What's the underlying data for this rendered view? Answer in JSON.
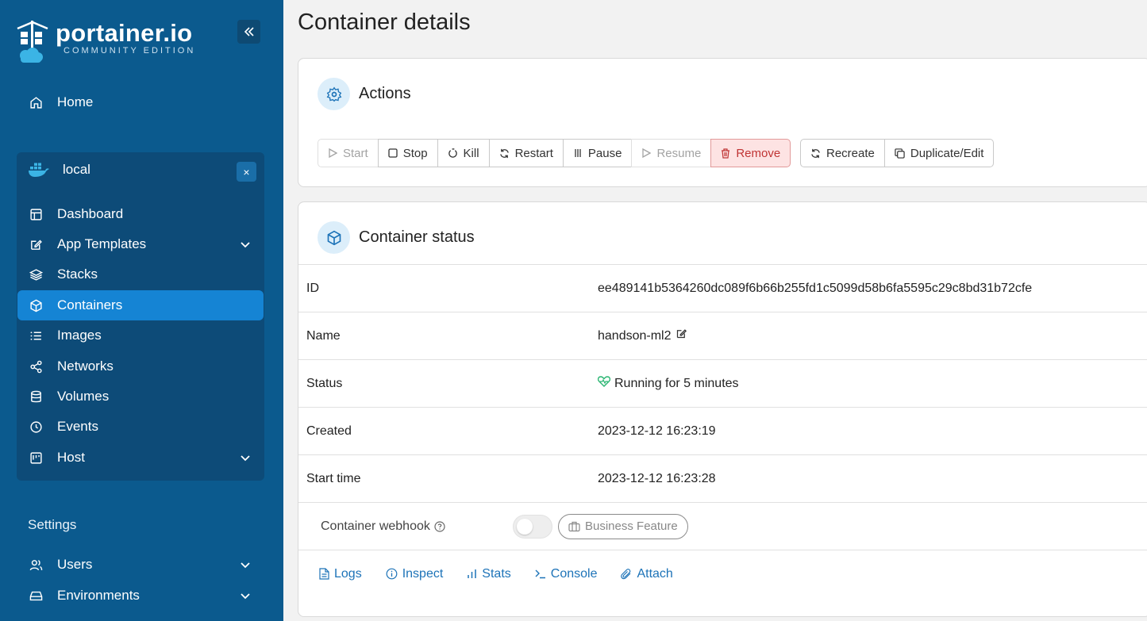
{
  "sidebar": {
    "logo_name": "portainer.io",
    "logo_sub": "COMMUNITY EDITION",
    "home": "Home",
    "environment": {
      "name": "local",
      "close": "×",
      "items": [
        {
          "label": "Dashboard",
          "icon": "dashboard-icon"
        },
        {
          "label": "App Templates",
          "icon": "edit-icon"
        },
        {
          "label": "Stacks",
          "icon": "layers-icon"
        },
        {
          "label": "Containers",
          "icon": "box-icon"
        },
        {
          "label": "Images",
          "icon": "list-icon"
        },
        {
          "label": "Networks",
          "icon": "share-icon"
        },
        {
          "label": "Volumes",
          "icon": "database-icon"
        },
        {
          "label": "Events",
          "icon": "clock-icon"
        },
        {
          "label": "Host",
          "icon": "board-icon"
        }
      ]
    },
    "settings_title": "Settings",
    "settings_items": [
      {
        "label": "Users",
        "icon": "users-icon"
      },
      {
        "label": "Environments",
        "icon": "drive-icon"
      }
    ]
  },
  "page": {
    "title": "Container details"
  },
  "actions": {
    "title": "Actions",
    "buttons": {
      "start": "Start",
      "stop": "Stop",
      "kill": "Kill",
      "restart": "Restart",
      "pause": "Pause",
      "resume": "Resume",
      "remove": "Remove",
      "recreate": "Recreate",
      "duplicate": "Duplicate/Edit"
    }
  },
  "status": {
    "title": "Container status",
    "rows": {
      "id": {
        "key": "ID",
        "value": "ee489141b5364260dc089f6b66b255fd1c5099d58b6fa5595c29c8bd31b72cfe"
      },
      "name": {
        "key": "Name",
        "value": "handson-ml2"
      },
      "status": {
        "key": "Status",
        "value": "Running for 5 minutes"
      },
      "created": {
        "key": "Created",
        "value": "2023-12-12 16:23:19"
      },
      "start_time": {
        "key": "Start time",
        "value": "2023-12-12 16:23:28"
      }
    },
    "webhook": {
      "label": "Container webhook",
      "business_feature": "Business Feature"
    },
    "links": {
      "logs": "Logs",
      "inspect": "Inspect",
      "stats": "Stats",
      "console": "Console",
      "attach": "Attach"
    }
  },
  "colors": {
    "sidebar_bg": "#0b5a8e",
    "active_item": "#1584d4",
    "link": "#1d73b8",
    "danger": "#c03434",
    "running": "#2bb673"
  }
}
